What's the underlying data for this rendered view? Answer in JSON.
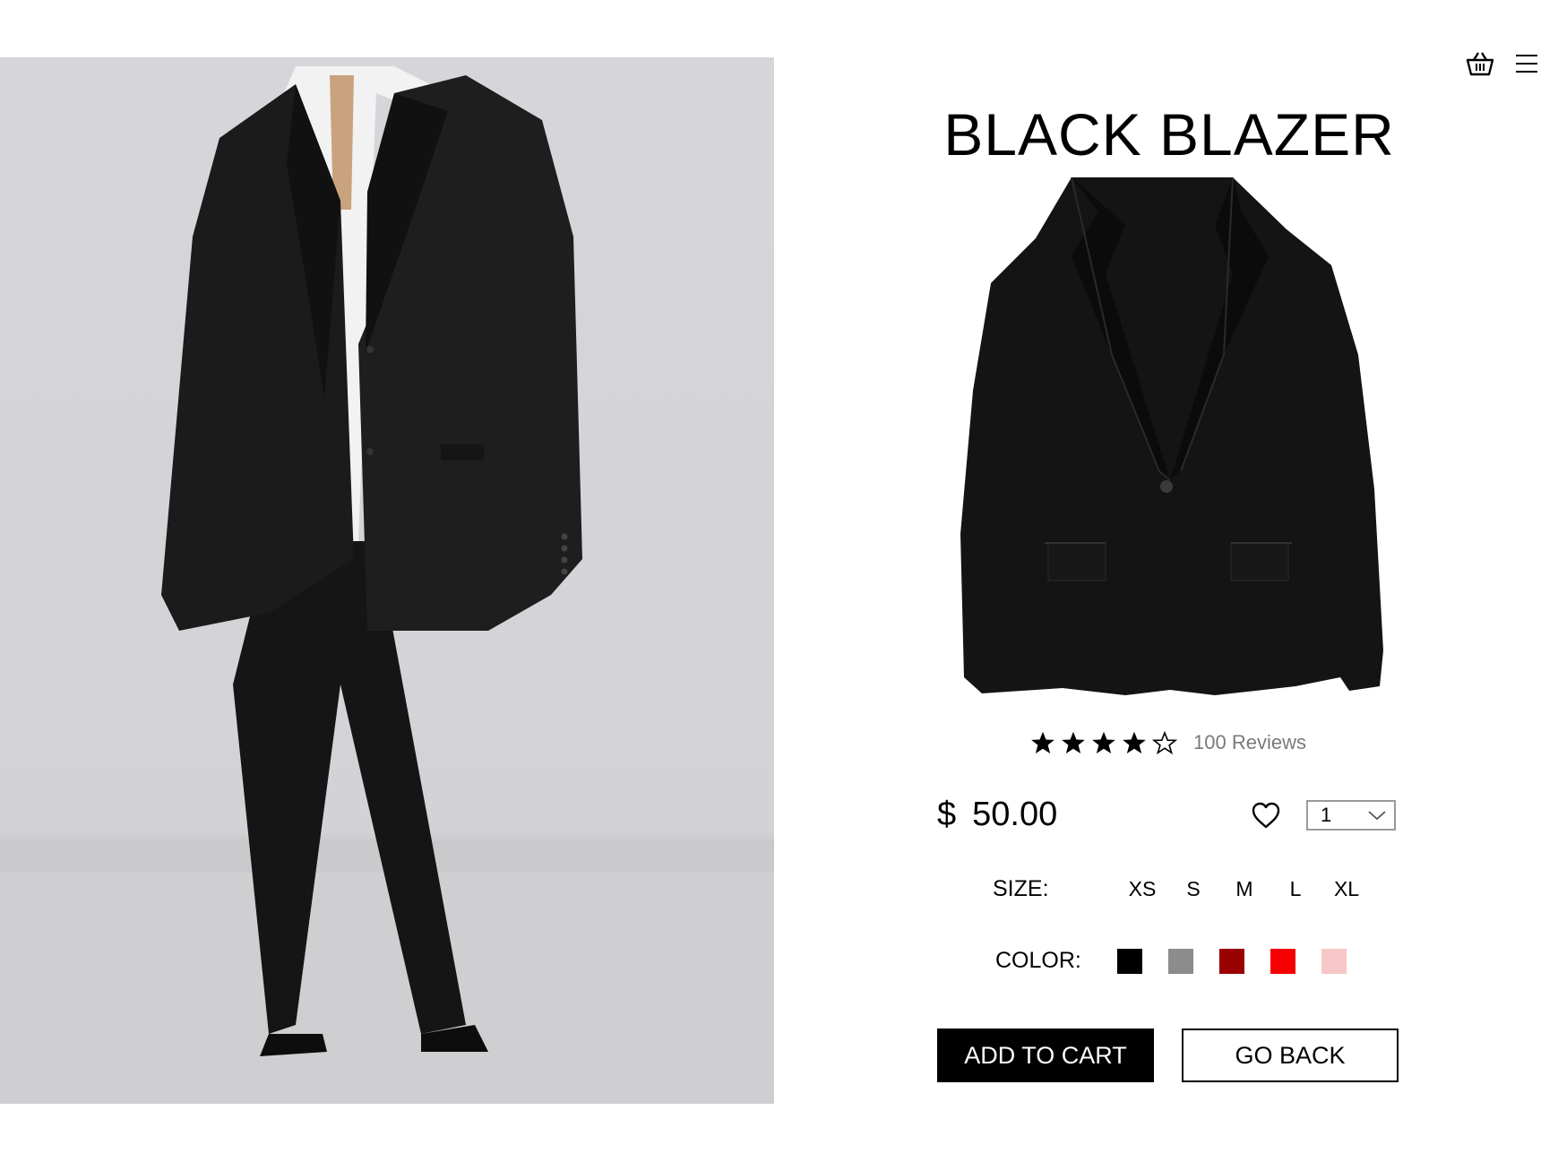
{
  "product": {
    "title": "BLACK BLAZER",
    "rating": 4,
    "rating_max": 5,
    "reviews_label": "100 Reviews",
    "currency": "$",
    "price": "50.00",
    "quantity": "1"
  },
  "size": {
    "label": "SIZE:",
    "options": [
      "XS",
      "S",
      "M",
      "L",
      "XL"
    ]
  },
  "color": {
    "label": "COLOR:",
    "swatches": [
      "#000000",
      "#8c8c8c",
      "#990000",
      "#f50000",
      "#f7c6c6"
    ]
  },
  "actions": {
    "add_to_cart": "ADD TO CART",
    "go_back": "GO BACK"
  },
  "icons": {
    "cart": "basket-icon",
    "menu": "hamburger-menu-icon",
    "wishlist": "heart-icon",
    "dropdown": "chevron-down-icon",
    "star": "star-icon"
  }
}
